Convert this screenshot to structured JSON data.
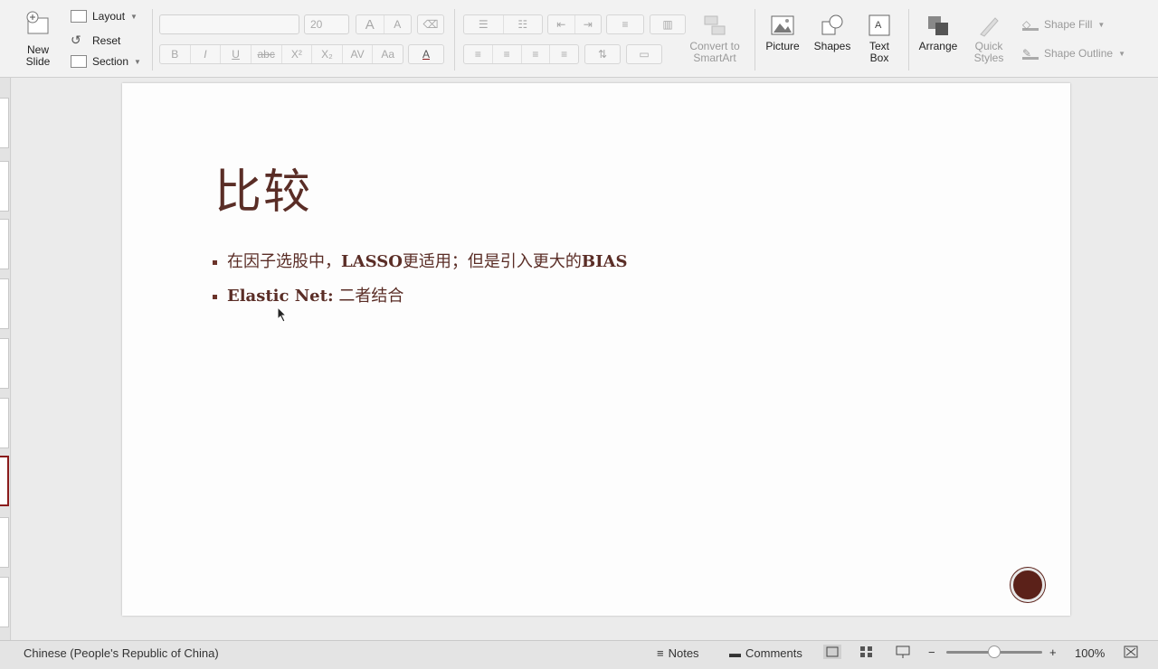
{
  "ribbon": {
    "new_slide": "New\nSlide",
    "layout": "Layout",
    "reset": "Reset",
    "section": "Section",
    "font_name": "",
    "font_size": "20",
    "font_grow": "A",
    "font_shrink": "A",
    "bold": "B",
    "italic": "I",
    "underline": "U",
    "strikethrough": "abc",
    "superscript": "X²",
    "subscript": "X₂",
    "convert_smartart": "Convert to\nSmartArt",
    "picture": "Picture",
    "shapes": "Shapes",
    "text_box": "Text\nBox",
    "arrange": "Arrange",
    "quick_styles": "Quick\nStyles",
    "shape_fill": "Shape Fill",
    "shape_outline": "Shape Outline"
  },
  "slide": {
    "title": "比较",
    "bullet1_a": "在因子选股中，",
    "bullet1_b": "LASSO",
    "bullet1_c": "更适用；但是引入更大的",
    "bullet1_d": "BIAS",
    "bullet2_a": "Elastic Net:",
    "bullet2_b": " 二者结合"
  },
  "status": {
    "language": "Chinese (People's Republic of China)",
    "notes": "Notes",
    "comments": "Comments",
    "zoom": "100%"
  },
  "colors": {
    "title_text": "#5a2d26",
    "accent": "#8a1c1c",
    "record_button": "#5b2119"
  }
}
